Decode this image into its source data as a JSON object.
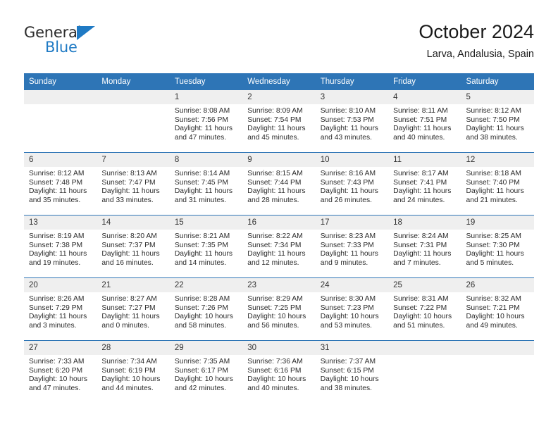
{
  "brand": {
    "name_top": "General",
    "name_bottom": "Blue",
    "accent_color": "#1f7ac4"
  },
  "header": {
    "title": "October 2024",
    "subtitle": "Larva, Andalusia, Spain"
  },
  "theme": {
    "header_bar_color": "#2e75b6",
    "daynum_band_color": "#efefef",
    "text_color": "#2b2b2b"
  },
  "weekdays": [
    "Sunday",
    "Monday",
    "Tuesday",
    "Wednesday",
    "Thursday",
    "Friday",
    "Saturday"
  ],
  "weeks": [
    [
      {
        "day": "",
        "lines": []
      },
      {
        "day": "",
        "lines": []
      },
      {
        "day": "1",
        "lines": [
          "Sunrise: 8:08 AM",
          "Sunset: 7:56 PM",
          "Daylight: 11 hours",
          "and 47 minutes."
        ]
      },
      {
        "day": "2",
        "lines": [
          "Sunrise: 8:09 AM",
          "Sunset: 7:54 PM",
          "Daylight: 11 hours",
          "and 45 minutes."
        ]
      },
      {
        "day": "3",
        "lines": [
          "Sunrise: 8:10 AM",
          "Sunset: 7:53 PM",
          "Daylight: 11 hours",
          "and 43 minutes."
        ]
      },
      {
        "day": "4",
        "lines": [
          "Sunrise: 8:11 AM",
          "Sunset: 7:51 PM",
          "Daylight: 11 hours",
          "and 40 minutes."
        ]
      },
      {
        "day": "5",
        "lines": [
          "Sunrise: 8:12 AM",
          "Sunset: 7:50 PM",
          "Daylight: 11 hours",
          "and 38 minutes."
        ]
      }
    ],
    [
      {
        "day": "6",
        "lines": [
          "Sunrise: 8:12 AM",
          "Sunset: 7:48 PM",
          "Daylight: 11 hours",
          "and 35 minutes."
        ]
      },
      {
        "day": "7",
        "lines": [
          "Sunrise: 8:13 AM",
          "Sunset: 7:47 PM",
          "Daylight: 11 hours",
          "and 33 minutes."
        ]
      },
      {
        "day": "8",
        "lines": [
          "Sunrise: 8:14 AM",
          "Sunset: 7:45 PM",
          "Daylight: 11 hours",
          "and 31 minutes."
        ]
      },
      {
        "day": "9",
        "lines": [
          "Sunrise: 8:15 AM",
          "Sunset: 7:44 PM",
          "Daylight: 11 hours",
          "and 28 minutes."
        ]
      },
      {
        "day": "10",
        "lines": [
          "Sunrise: 8:16 AM",
          "Sunset: 7:43 PM",
          "Daylight: 11 hours",
          "and 26 minutes."
        ]
      },
      {
        "day": "11",
        "lines": [
          "Sunrise: 8:17 AM",
          "Sunset: 7:41 PM",
          "Daylight: 11 hours",
          "and 24 minutes."
        ]
      },
      {
        "day": "12",
        "lines": [
          "Sunrise: 8:18 AM",
          "Sunset: 7:40 PM",
          "Daylight: 11 hours",
          "and 21 minutes."
        ]
      }
    ],
    [
      {
        "day": "13",
        "lines": [
          "Sunrise: 8:19 AM",
          "Sunset: 7:38 PM",
          "Daylight: 11 hours",
          "and 19 minutes."
        ]
      },
      {
        "day": "14",
        "lines": [
          "Sunrise: 8:20 AM",
          "Sunset: 7:37 PM",
          "Daylight: 11 hours",
          "and 16 minutes."
        ]
      },
      {
        "day": "15",
        "lines": [
          "Sunrise: 8:21 AM",
          "Sunset: 7:35 PM",
          "Daylight: 11 hours",
          "and 14 minutes."
        ]
      },
      {
        "day": "16",
        "lines": [
          "Sunrise: 8:22 AM",
          "Sunset: 7:34 PM",
          "Daylight: 11 hours",
          "and 12 minutes."
        ]
      },
      {
        "day": "17",
        "lines": [
          "Sunrise: 8:23 AM",
          "Sunset: 7:33 PM",
          "Daylight: 11 hours",
          "and 9 minutes."
        ]
      },
      {
        "day": "18",
        "lines": [
          "Sunrise: 8:24 AM",
          "Sunset: 7:31 PM",
          "Daylight: 11 hours",
          "and 7 minutes."
        ]
      },
      {
        "day": "19",
        "lines": [
          "Sunrise: 8:25 AM",
          "Sunset: 7:30 PM",
          "Daylight: 11 hours",
          "and 5 minutes."
        ]
      }
    ],
    [
      {
        "day": "20",
        "lines": [
          "Sunrise: 8:26 AM",
          "Sunset: 7:29 PM",
          "Daylight: 11 hours",
          "and 3 minutes."
        ]
      },
      {
        "day": "21",
        "lines": [
          "Sunrise: 8:27 AM",
          "Sunset: 7:27 PM",
          "Daylight: 11 hours",
          "and 0 minutes."
        ]
      },
      {
        "day": "22",
        "lines": [
          "Sunrise: 8:28 AM",
          "Sunset: 7:26 PM",
          "Daylight: 10 hours",
          "and 58 minutes."
        ]
      },
      {
        "day": "23",
        "lines": [
          "Sunrise: 8:29 AM",
          "Sunset: 7:25 PM",
          "Daylight: 10 hours",
          "and 56 minutes."
        ]
      },
      {
        "day": "24",
        "lines": [
          "Sunrise: 8:30 AM",
          "Sunset: 7:23 PM",
          "Daylight: 10 hours",
          "and 53 minutes."
        ]
      },
      {
        "day": "25",
        "lines": [
          "Sunrise: 8:31 AM",
          "Sunset: 7:22 PM",
          "Daylight: 10 hours",
          "and 51 minutes."
        ]
      },
      {
        "day": "26",
        "lines": [
          "Sunrise: 8:32 AM",
          "Sunset: 7:21 PM",
          "Daylight: 10 hours",
          "and 49 minutes."
        ]
      }
    ],
    [
      {
        "day": "27",
        "lines": [
          "Sunrise: 7:33 AM",
          "Sunset: 6:20 PM",
          "Daylight: 10 hours",
          "and 47 minutes."
        ]
      },
      {
        "day": "28",
        "lines": [
          "Sunrise: 7:34 AM",
          "Sunset: 6:19 PM",
          "Daylight: 10 hours",
          "and 44 minutes."
        ]
      },
      {
        "day": "29",
        "lines": [
          "Sunrise: 7:35 AM",
          "Sunset: 6:17 PM",
          "Daylight: 10 hours",
          "and 42 minutes."
        ]
      },
      {
        "day": "30",
        "lines": [
          "Sunrise: 7:36 AM",
          "Sunset: 6:16 PM",
          "Daylight: 10 hours",
          "and 40 minutes."
        ]
      },
      {
        "day": "31",
        "lines": [
          "Sunrise: 7:37 AM",
          "Sunset: 6:15 PM",
          "Daylight: 10 hours",
          "and 38 minutes."
        ]
      },
      {
        "day": "",
        "lines": []
      },
      {
        "day": "",
        "lines": []
      }
    ]
  ]
}
